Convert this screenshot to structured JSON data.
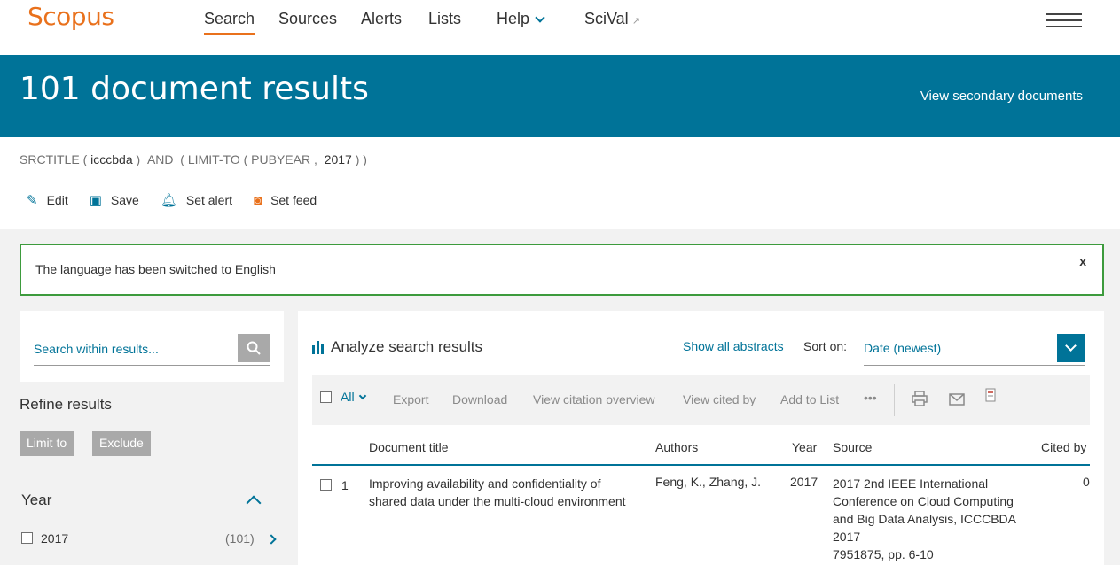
{
  "nav": {
    "logo": "Scopus",
    "items": [
      "Search",
      "Sources",
      "Alerts",
      "Lists",
      "Help",
      "SciVal"
    ],
    "external_arrow": "↗"
  },
  "banner": {
    "title": "101 document results",
    "secondary_link": "View secondary documents"
  },
  "query": {
    "field": "SRCTITLE",
    "term": "icccbda",
    "op": "AND",
    "limit": "LIMIT-TO",
    "limit_field": "PUBYEAR",
    "limit_value": "2017",
    "actions": [
      "Edit",
      "Save",
      "Set alert",
      "Set feed"
    ]
  },
  "alert": {
    "message": "The language has been switched to English",
    "close": "x"
  },
  "refine": {
    "search_placeholder": "Search within results...",
    "title": "Refine results",
    "limit_label": "Limit to",
    "exclude_label": "Exclude",
    "year_title": "Year",
    "year_items": [
      {
        "label": "2017",
        "count": "(101)"
      }
    ]
  },
  "results": {
    "analyze_label": "Analyze search results",
    "show_abstracts": "Show all abstracts",
    "sort_on_label": "Sort on:",
    "sort_value": "Date (newest)",
    "toolbar": {
      "all_label": "All",
      "items": [
        "Export",
        "Download",
        "View citation overview",
        "View cited by",
        "Add to List"
      ],
      "more": "•••"
    },
    "columns": [
      "Document title",
      "Authors",
      "Year",
      "Source",
      "Cited by"
    ],
    "rows": [
      {
        "num": "1",
        "title": "Improving availability and confidentiality of shared data under the multi-cloud environment",
        "authors": "Feng, K., Zhang, J.",
        "year": "2017",
        "source_lines": [
          "2017 2nd IEEE International Conference on Cloud Computing and Big Data Analysis, ICCCBDA 2017",
          "7951875, pp. 6-10"
        ],
        "cited": "0"
      }
    ]
  },
  "colors": {
    "brand_orange": "#e9711c",
    "banner_blue": "#007398",
    "alert_green": "#3d9b3d"
  }
}
